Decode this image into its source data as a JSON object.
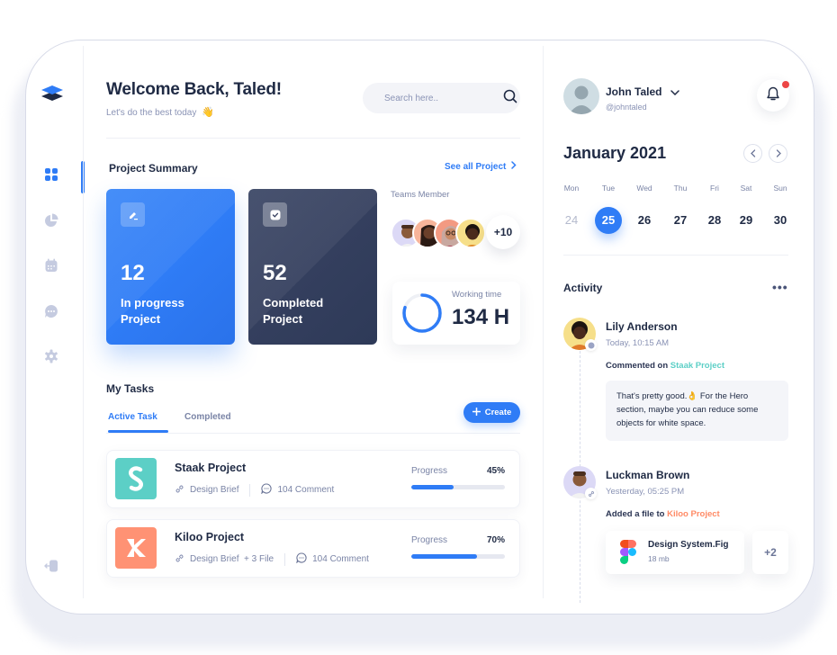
{
  "brand": {
    "logo_icon": "layers-icon"
  },
  "sidebar": {
    "items": [
      {
        "name": "dashboard",
        "icon": "grid-icon",
        "active": true
      },
      {
        "name": "analytics",
        "icon": "pie-chart-icon",
        "active": false
      },
      {
        "name": "calendar",
        "icon": "calendar-icon",
        "active": false
      },
      {
        "name": "messages",
        "icon": "chat-icon",
        "active": false
      },
      {
        "name": "settings",
        "icon": "gear-icon",
        "active": false
      }
    ],
    "logout_icon": "logout-icon"
  },
  "header": {
    "title": "Welcome Back, Taled!",
    "subtitle": "Let's do the best today",
    "subtitle_emoji": "👋",
    "search_placeholder": "Search here.."
  },
  "project_summary": {
    "title": "Project Summary",
    "see_all": "See all Project",
    "cards": [
      {
        "count": "12",
        "label_line1": "In progress",
        "label_line2": "Project",
        "icon": "edit-icon",
        "color": "#2f7cf6"
      },
      {
        "count": "52",
        "label_line1": "Completed",
        "label_line2": "Project",
        "icon": "check-square-icon",
        "color": "#363f5e"
      }
    ],
    "teams": {
      "label": "Teams Member",
      "extra_count": "+10",
      "avatar_colors": [
        "#dcd9f6",
        "#f7b49a",
        "#f39a82",
        "#f6df8a"
      ]
    },
    "working_time": {
      "label": "Working time",
      "value": "134 H",
      "ring_fraction": 0.8
    }
  },
  "tasks": {
    "title": "My Tasks",
    "tabs": [
      {
        "label": "Active Task",
        "active": true
      },
      {
        "label": "Completed",
        "active": false
      }
    ],
    "create_label": "Create",
    "items": [
      {
        "name": "Staak Project",
        "logo_letter": "S",
        "logo_color": "#5ccfc6",
        "attachment": "Design Brief",
        "comments": "104 Comment",
        "progress_label": "Progress",
        "progress_text": "45%",
        "progress": 45
      },
      {
        "name": "Kiloo Project",
        "logo_letter": "K",
        "logo_color": "#ff9274",
        "attachment": "Design Brief  + 3 File",
        "comments": "104 Comment",
        "progress_label": "Progress",
        "progress_text": "70%",
        "progress": 70
      }
    ]
  },
  "profile": {
    "name": "John Taled",
    "handle": "@johntaled",
    "has_notifications": true
  },
  "calendar": {
    "month": "January 2021",
    "weekdays": [
      "Mon",
      "Tue",
      "Wed",
      "Thu",
      "Fri",
      "Sat",
      "Sun"
    ],
    "days": [
      {
        "d": "24",
        "state": "muted"
      },
      {
        "d": "25",
        "state": "selected"
      },
      {
        "d": "26",
        "state": "normal"
      },
      {
        "d": "27",
        "state": "normal"
      },
      {
        "d": "28",
        "state": "normal"
      },
      {
        "d": "29",
        "state": "normal"
      },
      {
        "d": "30",
        "state": "normal"
      }
    ]
  },
  "activity": {
    "title": "Activity",
    "more_label": "•••",
    "items": [
      {
        "name": "Lily Anderson",
        "time": "Today, 10:15 AM",
        "action": "Commented on",
        "target": "Staak Project",
        "comment": "That's pretty good.👌 For the Hero section, maybe you can reduce some objects for white space.",
        "avatar_color": "#f6df8a"
      },
      {
        "name": "Luckman Brown",
        "time": "Yesterday, 05:25 PM",
        "action": "Added a file to",
        "target": "Kiloo Project",
        "file_name": "Design System.Fig",
        "file_size": "18 mb",
        "more_files": "+2",
        "avatar_color": "#dcd9f6"
      }
    ]
  },
  "colors": {
    "accent": "#2f7cf6",
    "dark": "#1f2a44",
    "teal": "#5ccfc6",
    "orange": "#ff8a65",
    "notification": "#ec4545"
  }
}
